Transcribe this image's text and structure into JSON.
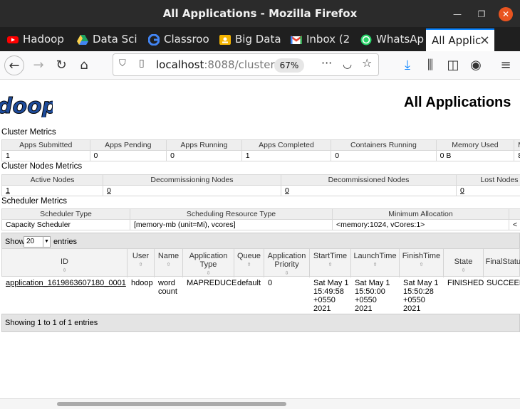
{
  "window": {
    "title": "All Applications - Mozilla Firefox"
  },
  "tabs": [
    {
      "label": "Hadoop",
      "icon": "youtube-icon",
      "color": "#ff0000"
    },
    {
      "label": "Data Sci",
      "icon": "google-drive-icon",
      "color": "#1fa463"
    },
    {
      "label": "Classroo",
      "icon": "google-icon",
      "color": "#4285f4"
    },
    {
      "label": "Big Data",
      "icon": "classroom-icon",
      "color": "#f4b400"
    },
    {
      "label": "Inbox (2",
      "icon": "gmail-icon",
      "color": "#ea4335"
    },
    {
      "label": "WhatsAp",
      "icon": "whatsapp-icon",
      "color": "#25d366"
    },
    {
      "label": "All Applic",
      "icon": "none",
      "color": "#ffffff"
    }
  ],
  "nav": {
    "url_host": "localhost",
    "url_rest": ":8088/cluster",
    "zoom": "67%"
  },
  "page": {
    "heading": "All Applications",
    "logo_text": "doop",
    "cluster_metrics": {
      "title": "Cluster Metrics",
      "headers": [
        "Apps Submitted",
        "Apps Pending",
        "Apps Running",
        "Apps Completed",
        "Containers Running",
        "Memory Used",
        "M"
      ],
      "values": [
        "1",
        "0",
        "0",
        "1",
        "0",
        "0 B",
        "8"
      ]
    },
    "nodes_metrics": {
      "title": "Cluster Nodes Metrics",
      "headers": [
        "Active Nodes",
        "Decommissioning Nodes",
        "Decommissioned Nodes",
        "Lost Nodes"
      ],
      "values": [
        "1",
        "0",
        "0",
        "0"
      ]
    },
    "scheduler_metrics": {
      "title": "Scheduler Metrics",
      "headers": [
        "Scheduler Type",
        "Scheduling Resource Type",
        "Minimum Allocation",
        ""
      ],
      "values": [
        "Capacity Scheduler",
        "[memory-mb (unit=Mi), vcores]",
        "<memory:1024, vCores:1>",
        "<"
      ]
    },
    "table_controls": {
      "show_label": "Show",
      "page_size": "20",
      "entries_label": "entries"
    },
    "apps_table": {
      "headers": [
        "ID",
        "User",
        "Name",
        "Application Type",
        "Queue",
        "Application Priority",
        "StartTime",
        "LaunchTime",
        "FinishTime",
        "State",
        "FinalStatus"
      ],
      "rows": [
        {
          "id": "application_1619863607180_0001",
          "user": "hdoop",
          "name": "word count",
          "type": "MAPREDUCE",
          "queue": "default",
          "priority": "0",
          "start": "Sat May 1 15:49:58 +0550 2021",
          "launch": "Sat May 1 15:50:00 +0550 2021",
          "finish": "Sat May 1 15:50:28 +0550 2021",
          "state": "FINISHED",
          "final": "SUCCEEDED"
        }
      ]
    },
    "footer": "Showing 1 to 1 of 1 entries"
  }
}
